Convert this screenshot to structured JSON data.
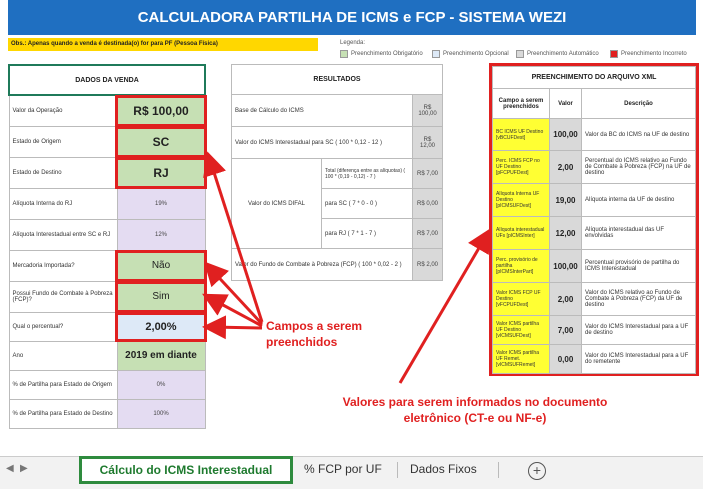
{
  "banner": {
    "title": "CALCULADORA PARTILHA DE ICMS e FCP - SISTEMA WEZI"
  },
  "obs": "Obs.: Apenas quando a venda é destinada(o) for para PF (Pessoa Física)",
  "legend": {
    "title": "Legenda:",
    "items": [
      {
        "label": "Preenchimento Obrigatório",
        "color": "#c6e0b4"
      },
      {
        "label": "Preenchimento Opcional",
        "color": "#dde9f7"
      },
      {
        "label": "Preenchimento Automático",
        "color": "#d9d9d9"
      },
      {
        "label": "Preenchimento Incorreto",
        "color": "#e02020"
      }
    ]
  },
  "dados_venda": {
    "header": "DADOS DA VENDA",
    "rows": [
      {
        "label": "Valor da Operação",
        "value": "R$ 100,00"
      },
      {
        "label": "Estado de Origem",
        "value": "SC"
      },
      {
        "label": "Estado de Destino",
        "value": "RJ"
      },
      {
        "label": "Alíquota Interna do RJ",
        "value": "19%"
      },
      {
        "label": "Alíquota Interestadual entre SC e RJ",
        "value": "12%"
      },
      {
        "label": "Mercadoria Importada?",
        "value": "Não"
      },
      {
        "label": "Possui Fundo de Combate à Pobreza (FCP)?",
        "value": "Sim"
      },
      {
        "label": "Qual o percentual?",
        "value": "2,00%"
      },
      {
        "label": "Ano",
        "value": "2019 em diante"
      },
      {
        "label": "% de Partilha para Estado de Origem",
        "value": "0%"
      },
      {
        "label": "% de Partilha para Estado de Destino",
        "value": "100%"
      }
    ]
  },
  "resultados": {
    "header": "RESULTADOS",
    "base": {
      "label": "Base de Cálculo do ICMS",
      "value": "R$ 100,00"
    },
    "inter": {
      "label": "Valor do ICMS Interestadual para SC ( 100 * 0,12 - 12 )",
      "value": "R$ 12,00"
    },
    "difal_label": "Valor do ICMS DIFAL",
    "difal_total": {
      "label": "Total (diferença entre as alíquotas) ( 100 * (0,19 - 0,12) - 7 )",
      "value": "R$ 7,00"
    },
    "difal_sc": {
      "label": "para SC ( 7 * 0 - 0 )",
      "value": "R$ 0,00"
    },
    "difal_rj": {
      "label": "para RJ ( 7 * 1 - 7 )",
      "value": "R$ 7,00"
    },
    "fcp": {
      "label": "Valor do Fundo de Combate à Pobreza (FCP) ( 100 * 0,02 - 2 )",
      "value": "R$ 2,00"
    }
  },
  "xml": {
    "header": "PREENCHIMENTO DO ARQUIVO XML",
    "col_campo": "Campo a serem preenchidos",
    "col_valor": "Valor",
    "col_desc": "Descrição",
    "rows": [
      {
        "campo": "BC ICMS UF Destino [vBCUFDest]",
        "valor": "100,00",
        "desc": "Valor da BC do ICMS na UF de destino"
      },
      {
        "campo": "Perc. ICMS FCP no UF Destino [pFCPUFDest]",
        "valor": "2,00",
        "desc": "Percentual do ICMS relativo ao Fundo de Combate à Pobreza (FCP) na UF de destino"
      },
      {
        "campo": "Alíquota Interna UF Destino [pICMSUFDest]",
        "valor": "19,00",
        "desc": "Alíquota interna da UF de destino"
      },
      {
        "campo": "Alíquota interestadual UFs [pICMSInter]",
        "valor": "12,00",
        "desc": "Alíquota interestadual das UF envolvidas"
      },
      {
        "campo": "Perc. provisório de partilha [pICMSInterPart]",
        "valor": "100,00",
        "desc": "Percentual provisório de partilha do ICMS Interestadual"
      },
      {
        "campo": "Valor ICMS FCP UF Destino [vFCPUFDest]",
        "valor": "2,00",
        "desc": "Valor do ICMS relativo ao Fundo de Combate à Pobreza (FCP) da UF de destino"
      },
      {
        "campo": "Valor ICMS partilha UF Destino [vICMSUFDest]",
        "valor": "7,00",
        "desc": "Valor do ICMS Interestadual para a UF de destino"
      },
      {
        "campo": "Valor ICMS partilha UF Remet. [vICMSUFRemet]",
        "valor": "0,00",
        "desc": "Valor do ICMS Interestadual para a UF do remetente"
      }
    ]
  },
  "annotations": {
    "campos": "Campos a serem preenchidos",
    "valores": "Valores para serem informados no documento eletrônico (CT-e ou NF-e)"
  },
  "tabs": {
    "active": "Cálculo do ICMS Interestadual",
    "t2": "% FCP por UF",
    "t3": "Dados Fixos",
    "add": "+"
  },
  "colors": {
    "accent_red": "#e02020",
    "banner": "#1f6fc1"
  }
}
